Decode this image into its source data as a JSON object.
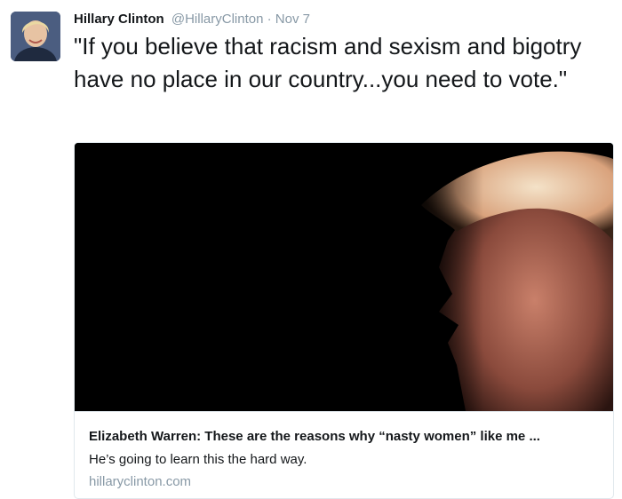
{
  "tweet": {
    "author_name": "Hillary Clinton",
    "author_handle": "@HillaryClinton",
    "separator": "·",
    "timestamp": "Nov 7",
    "text": "\"If you believe that racism and sexism and bigotry have no place in our country...you need to vote.\""
  },
  "card": {
    "title": "Elizabeth Warren: These are the reasons why “nasty women” like me ...",
    "description": "He’s going to learn this the hard way.",
    "domain": "hillaryclinton.com"
  },
  "colors": {
    "name": "#14171a",
    "secondary": "#8899a6",
    "border": "#e1e8ed",
    "image_bg": "#000000"
  }
}
